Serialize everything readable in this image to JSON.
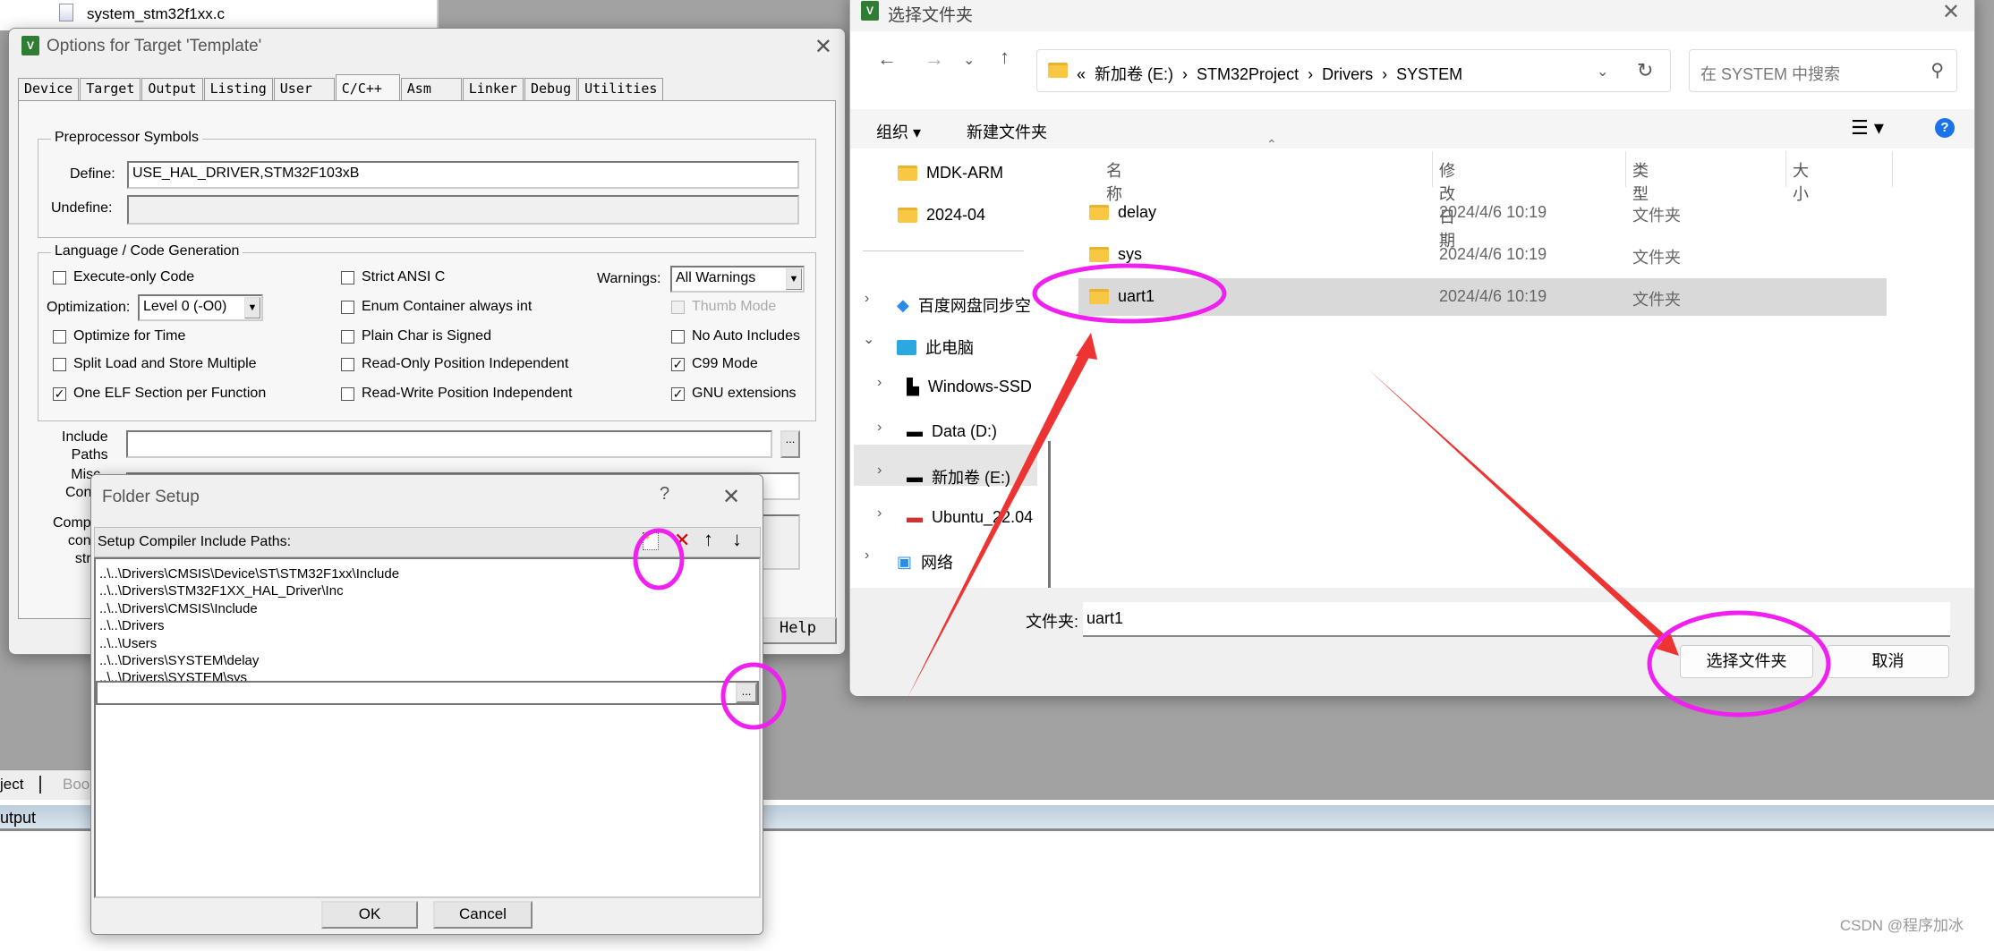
{
  "background": {
    "tree_file": "system_stm32f1xx.c",
    "bottom_tabs": [
      "ject",
      "Boo"
    ],
    "output_label": "utput"
  },
  "options": {
    "title": "Options for Target 'Template'",
    "tabs": [
      "Device",
      "Target",
      "Output",
      "Listing",
      "User",
      "C/C++",
      "Asm",
      "Linker",
      "Debug",
      "Utilities"
    ],
    "active_tab": "C/C++",
    "pre": {
      "group": "Preprocessor Symbols",
      "define_label": "Define:",
      "define_value": "USE_HAL_DRIVER,STM32F103xB",
      "undefine_label": "Undefine:",
      "undefine_value": ""
    },
    "lang": {
      "group": "Language / Code Generation",
      "warnings_label": "Warnings:",
      "warnings_value": "All Warnings",
      "optimization_label": "Optimization:",
      "optimization_value": "Level 0 (-O0)",
      "col1": [
        {
          "label": "Execute-only Code",
          "checked": false
        },
        {
          "label": "Optimize for Time",
          "checked": false
        },
        {
          "label": "Split Load and Store Multiple",
          "checked": false
        },
        {
          "label": "One ELF Section per Function",
          "checked": true
        }
      ],
      "col2": [
        {
          "label": "Strict ANSI C",
          "checked": false
        },
        {
          "label": "Enum Container always int",
          "checked": false
        },
        {
          "label": "Plain Char is Signed",
          "checked": false
        },
        {
          "label": "Read-Only Position Independent",
          "checked": false
        },
        {
          "label": "Read-Write Position Independent",
          "checked": false
        }
      ],
      "col3": [
        {
          "label": "Thumb Mode",
          "checked": false,
          "disabled": true
        },
        {
          "label": "No Auto Includes",
          "checked": false
        },
        {
          "label": "C99 Mode",
          "checked": true
        },
        {
          "label": "GNU extensions",
          "checked": true
        }
      ]
    },
    "include_label_1": "Include",
    "include_label_2": "Paths",
    "misc_label_1": "Misc",
    "misc_label_2": "Contr",
    "comp_label_1": "Comp",
    "comp_label_2": "con",
    "comp_label_3": "str",
    "browse": "...",
    "help": "Help"
  },
  "folder_setup": {
    "title": "Folder Setup",
    "help": "?",
    "toolbar_label": "Setup Compiler Include Paths:",
    "paths": [
      "..\\..\\Drivers\\CMSIS\\Device\\ST\\STM32F1xx\\Include",
      "..\\..\\Drivers\\STM32F1XX_HAL_Driver\\Inc",
      "..\\..\\Drivers\\CMSIS\\Include",
      "..\\..\\Drivers",
      "..\\..\\Users",
      "..\\..\\Drivers\\SYSTEM\\delay",
      "..\\..\\Drivers\\SYSTEM\\sys"
    ],
    "edit_value": "",
    "browse": "...",
    "ok": "OK",
    "cancel": "Cancel"
  },
  "picker": {
    "title": "选择文件夹",
    "breadcrumb": [
      "«",
      "新加卷 (E:)",
      "STM32Project",
      "Drivers",
      "SYSTEM"
    ],
    "search_placeholder": "在 SYSTEM 中搜索",
    "organize": "组织 ▾",
    "new_folder": "新建文件夹",
    "columns": [
      "名称",
      "修改日期",
      "类型",
      "大小"
    ],
    "rows": [
      {
        "name": "delay",
        "date": "2024/4/6 10:19",
        "type": "文件夹"
      },
      {
        "name": "sys",
        "date": "2024/4/6 10:19",
        "type": "文件夹"
      },
      {
        "name": "uart1",
        "date": "2024/4/6 10:19",
        "type": "文件夹",
        "selected": true
      }
    ],
    "nav": [
      "MDK-ARM",
      "2024-04",
      "百度网盘同步空",
      "此电脑",
      "Windows-SSD",
      "Data (D:)",
      "新加卷 (E:)",
      "Ubuntu_22.04",
      "网络"
    ],
    "folder_label": "文件夹:",
    "folder_value": "uart1",
    "select_button": "选择文件夹",
    "cancel_button": "取消"
  },
  "watermark": "CSDN @程序加冰",
  "colors": {
    "annotation_ellipse": "#f020f0",
    "annotation_arrow": "#ee3333",
    "selection": "#d9d9d9"
  }
}
